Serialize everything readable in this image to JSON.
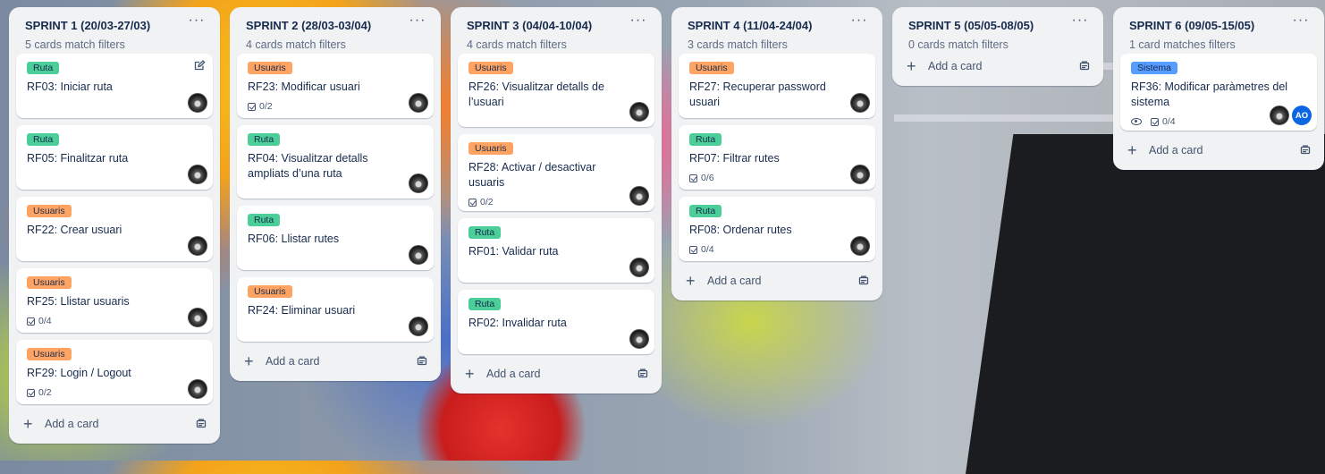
{
  "add_card_label": "Add a card",
  "label_colors": {
    "Ruta": "#4bce97",
    "Usuaris": "#fea362",
    "Sistema": "#579dff"
  },
  "lists": [
    {
      "title": "SPRINT 1 (20/03-27/03)",
      "subtitle": "5 cards match filters",
      "cards": [
        {
          "label": "Ruta",
          "title": "RF03: Iniciar ruta",
          "checklist": null,
          "edit_icon": true
        },
        {
          "label": "Ruta",
          "title": "RF05: Finalitzar ruta",
          "checklist": null
        },
        {
          "label": "Usuaris",
          "title": "RF22: Crear usuari",
          "checklist": null
        },
        {
          "label": "Usuaris",
          "title": "RF25: Llistar usuaris",
          "checklist": "0/4"
        },
        {
          "label": "Usuaris",
          "title": "RF29: Login / Logout",
          "checklist": "0/2"
        }
      ]
    },
    {
      "title": "SPRINT 2 (28/03-03/04)",
      "subtitle": "4 cards match filters",
      "cards": [
        {
          "label": "Usuaris",
          "title": "RF23: Modificar usuari",
          "checklist": "0/2"
        },
        {
          "label": "Ruta",
          "title": "RF04: Visualitzar detalls ampliats d’una ruta",
          "checklist": null
        },
        {
          "label": "Ruta",
          "title": "RF06: Llistar rutes",
          "checklist": null
        },
        {
          "label": "Usuaris",
          "title": "RF24: Eliminar usuari",
          "checklist": null
        }
      ]
    },
    {
      "title": "SPRINT 3 (04/04-10/04)",
      "subtitle": "4 cards match filters",
      "cards": [
        {
          "label": "Usuaris",
          "title": "RF26: Visualitzar detalls de l’usuari",
          "checklist": null
        },
        {
          "label": "Usuaris",
          "title": "RF28: Activar / desactivar usuaris",
          "checklist": "0/2"
        },
        {
          "label": "Ruta",
          "title": "RF01: Validar ruta",
          "checklist": null
        },
        {
          "label": "Ruta",
          "title": "RF02: Invalidar ruta",
          "checklist": null
        }
      ]
    },
    {
      "title": "SPRINT 4 (11/04-24/04)",
      "subtitle": "3 cards match filters",
      "cards": [
        {
          "label": "Usuaris",
          "title": "RF27: Recuperar password usuari",
          "checklist": null
        },
        {
          "label": "Ruta",
          "title": "RF07: Filtrar rutes",
          "checklist": "0/6"
        },
        {
          "label": "Ruta",
          "title": "RF08: Ordenar rutes",
          "checklist": "0/4"
        }
      ]
    },
    {
      "title": "SPRINT 5 (05/05-08/05)",
      "subtitle": "0 cards match filters",
      "cards": []
    },
    {
      "title": "SPRINT 6 (09/05-15/05)",
      "subtitle": "1 card matches filters",
      "cards": [
        {
          "label": "Sistema",
          "title": "RF36: Modificar paràmetres del sistema",
          "checklist": "0/4",
          "watching": true,
          "extra_member": "AO"
        }
      ]
    }
  ]
}
